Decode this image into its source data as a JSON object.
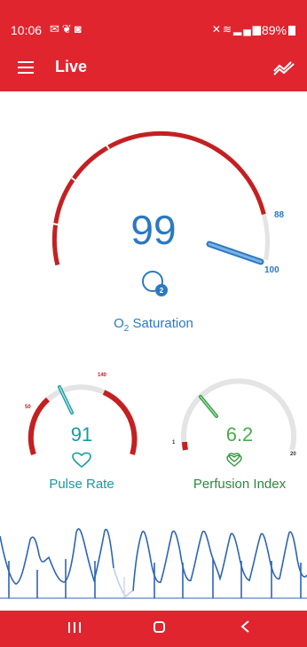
{
  "status_bar": {
    "time": "10:06",
    "left_icons": [
      "notification-icon",
      "app-icon",
      "mail-icon"
    ],
    "right_icons": [
      "mute-icon",
      "wifi-icon",
      "lte-icon",
      "signal-icon"
    ],
    "battery": "89%"
  },
  "app_bar": {
    "title": "Live",
    "menu_icon": "menu-icon",
    "trend_icon": "trend-icon"
  },
  "spo2": {
    "value": "99",
    "label_prefix": "O",
    "label_sub": "2",
    "label_suffix": " Saturation",
    "scale_low": "88",
    "scale_high": "100",
    "color": "#2b79c2"
  },
  "pulse_rate": {
    "value": "91",
    "label": "Pulse Rate",
    "scale_low": "50",
    "scale_high": "140",
    "color": "#179aa2"
  },
  "perfusion_index": {
    "value": "6.2",
    "label": "Perfusion Index",
    "scale_low": "1",
    "scale_high": "20",
    "color": "#4caa4f"
  },
  "colors": {
    "brand_red": "#e0252f",
    "gauge_red": "#c42022",
    "gauge_gray": "#e4e4e4",
    "wave_blue": "#2d64b4"
  },
  "nav_bar": {
    "recents": "recents-icon",
    "home": "home-icon",
    "back": "back-icon"
  }
}
